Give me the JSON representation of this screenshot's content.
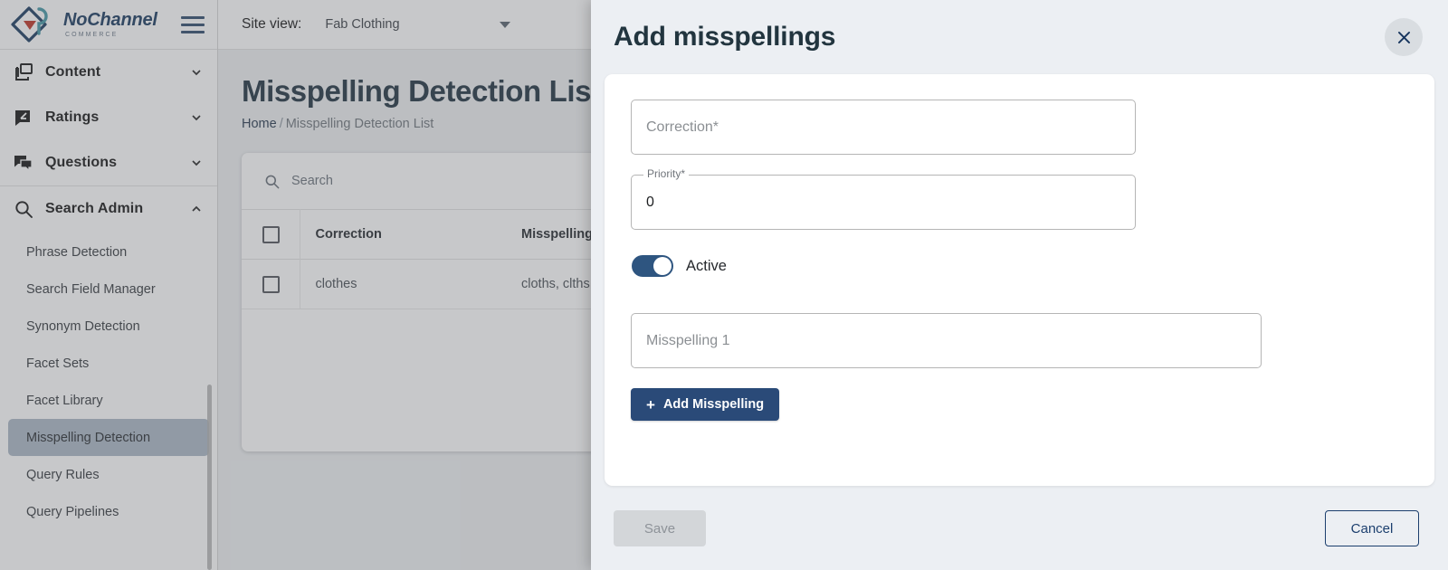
{
  "brand": {
    "name": "NoChannel",
    "tagline": "COMMERCE",
    "logo_icon": "nochannel-logo-icon",
    "menu_icon": "hamburger-menu-icon"
  },
  "sidebar": {
    "groups": [
      {
        "items": [
          {
            "label": "Content",
            "icon": "layers-icon",
            "chevron": "chevron-down-icon"
          },
          {
            "label": "Ratings",
            "icon": "rating-chat-icon",
            "chevron": "chevron-down-icon"
          },
          {
            "label": "Questions",
            "icon": "questions-chat-icon",
            "chevron": "chevron-down-icon"
          }
        ]
      }
    ],
    "search_admin": {
      "label": "Search Admin",
      "icon": "search-icon",
      "chevron": "chevron-up-icon",
      "expanded": true,
      "sub_items": [
        {
          "label": "Phrase Detection",
          "active": false
        },
        {
          "label": "Search Field Manager",
          "active": false
        },
        {
          "label": "Synonym Detection",
          "active": false
        },
        {
          "label": "Facet Sets",
          "active": false
        },
        {
          "label": "Facet Library",
          "active": false
        },
        {
          "label": "Misspelling Detection",
          "active": true
        },
        {
          "label": "Query Rules",
          "active": false
        },
        {
          "label": "Query Pipelines",
          "active": false
        }
      ]
    }
  },
  "topbar": {
    "site_view_label": "Site view:",
    "site_view_value": "Fab Clothing",
    "caret_icon": "caret-down-icon"
  },
  "page": {
    "title": "Misspelling Detection List",
    "breadcrumb": {
      "home": "Home",
      "separator": "/",
      "current": "Misspelling Detection List"
    }
  },
  "table": {
    "search_placeholder": "Search",
    "search_icon": "search-icon",
    "columns": [
      "Correction",
      "Misspellings"
    ],
    "rows": [
      {
        "correction": "clothes",
        "misspellings": "cloths, clths"
      }
    ]
  },
  "modal": {
    "title": "Add misspellings",
    "close_icon": "close-icon",
    "fields": {
      "correction": {
        "placeholder": "Correction*",
        "value": ""
      },
      "priority": {
        "label": "Priority*",
        "value": "0"
      },
      "misspelling_1": {
        "placeholder": "Misspelling 1",
        "value": ""
      }
    },
    "active_toggle": {
      "label": "Active",
      "state": "on"
    },
    "add_misspelling_button": {
      "label": "Add Misspelling",
      "icon": "plus-icon"
    },
    "footer": {
      "save_label": "Save",
      "save_disabled": true,
      "cancel_label": "Cancel"
    }
  },
  "colors": {
    "brand_navy": "#1f3f63",
    "accent_button": "#2a4a78",
    "toggle_on": "#2e5580",
    "sidebar_active": "#aebac7",
    "modal_bg": "#eceff3",
    "logo_red": "#c0392b",
    "logo_teal": "#4a9aa8"
  }
}
